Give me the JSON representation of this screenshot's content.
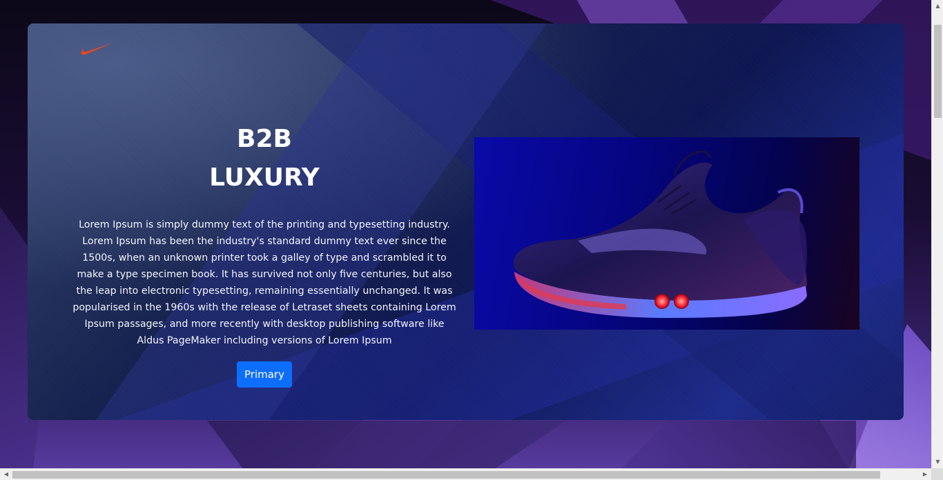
{
  "hero": {
    "logo_icon": "nike-swoosh-icon",
    "title_line1": "B2B",
    "title_line2": "LUXURY",
    "description": "Lorem Ipsum is simply dummy text of the printing and typesetting industry. Lorem Ipsum has been the industry's standard dummy text ever since the 1500s, when an unknown printer took a galley of type and scrambled it to make a type specimen book. It has survived not only five centuries, but also the leap into electronic typesetting, remaining essentially unchanged. It was popularised in the 1960s with the release of Letraset sheets containing Lorem Ipsum passages, and more recently with desktop publishing software like Aldus PageMaker including versions of Lorem Ipsum",
    "button_label": "Primary",
    "product_image": "sneaker-image"
  },
  "scrollbars": {
    "up_arrow": "▲",
    "down_arrow": "▼",
    "left_arrow": "◀",
    "right_arrow": "▶"
  },
  "colors": {
    "accent": "#0d6efd",
    "logo": "#e8471f"
  }
}
